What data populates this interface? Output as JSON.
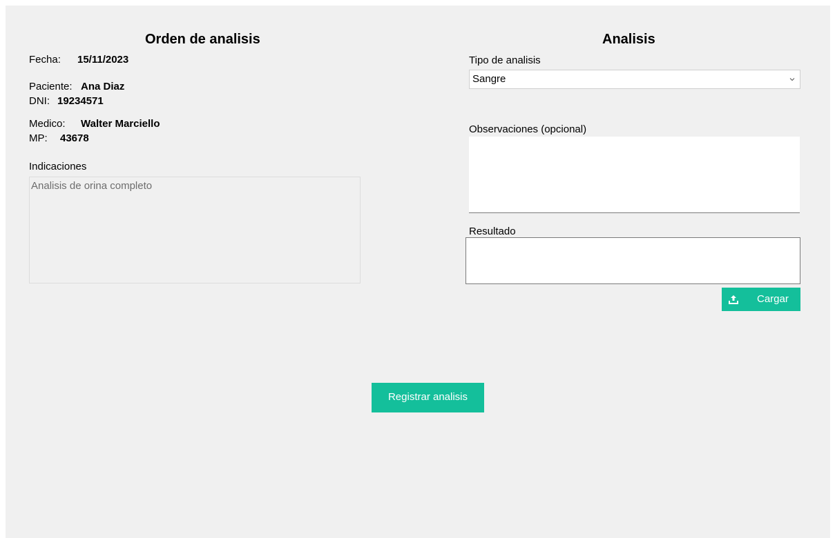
{
  "orden": {
    "title": "Orden de analisis",
    "fecha_label": "Fecha:",
    "fecha_value": "15/11/2023",
    "paciente_label": "Paciente:",
    "paciente_value": "Ana Diaz",
    "dni_label": "DNI:",
    "dni_value": "19234571",
    "medico_label": "Medico:",
    "medico_value": "Walter Marciello",
    "mp_label": "MP:",
    "mp_value": "43678",
    "indicaciones_label": "Indicaciones",
    "indicaciones_value": "Analisis de orina completo"
  },
  "analisis": {
    "title": "Analisis",
    "tipo_label": "Tipo de analisis",
    "tipo_value": "Sangre",
    "observaciones_label": "Observaciones (opcional)",
    "observaciones_value": "",
    "resultado_label": "Resultado",
    "resultado_value": "",
    "cargar_label": "Cargar"
  },
  "actions": {
    "registrar_label": "Registrar analisis"
  },
  "icons": {
    "upload": "upload-icon",
    "dropdown": "chevron-down-icon"
  },
  "colors": {
    "background": "#f0f0f0",
    "accent": "#14bf9b",
    "button_text": "#ffffff"
  }
}
